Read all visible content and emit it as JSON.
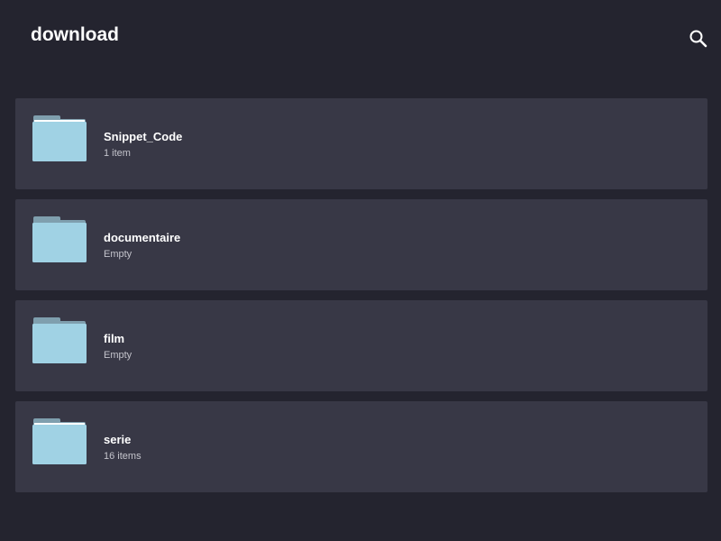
{
  "header": {
    "title": "download",
    "search_icon": "search-icon"
  },
  "colors": {
    "background": "#24242f",
    "row_background": "#383846",
    "folder_front": "#a0d2e4",
    "folder_back": "#7f9fae",
    "text_primary": "#ffffff",
    "text_secondary": "#c4c4cc"
  },
  "folders": [
    {
      "name": "Snippet_Code",
      "meta": "1 item",
      "icon": "folder-icon"
    },
    {
      "name": "documentaire",
      "meta": "Empty",
      "icon": "folder-icon"
    },
    {
      "name": "film",
      "meta": "Empty",
      "icon": "folder-icon"
    },
    {
      "name": "serie",
      "meta": "16 items",
      "icon": "folder-icon"
    }
  ]
}
